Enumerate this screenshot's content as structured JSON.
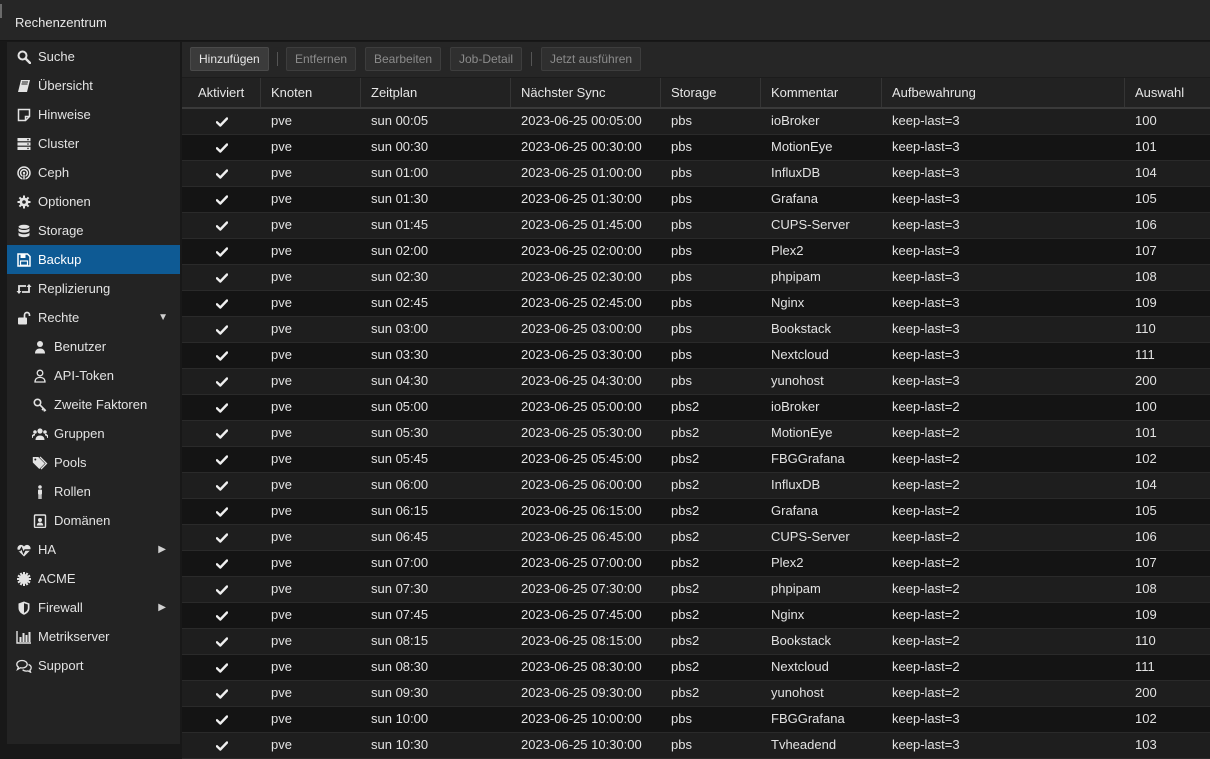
{
  "window": {
    "title": "Rechenzentrum"
  },
  "sidebar": {
    "items": [
      {
        "label": "Suche",
        "icon": "search-icon"
      },
      {
        "label": "Übersicht",
        "icon": "book-icon"
      },
      {
        "label": "Hinweise",
        "icon": "note-icon"
      },
      {
        "label": "Cluster",
        "icon": "server-icon"
      },
      {
        "label": "Ceph",
        "icon": "ceph-icon"
      },
      {
        "label": "Optionen",
        "icon": "gear-icon"
      },
      {
        "label": "Storage",
        "icon": "database-icon"
      },
      {
        "label": "Backup",
        "icon": "floppy-icon",
        "active": true
      },
      {
        "label": "Replizierung",
        "icon": "retweet-icon"
      },
      {
        "label": "Rechte",
        "icon": "unlock-icon",
        "expanded": true
      },
      {
        "label": "Benutzer",
        "icon": "user-icon",
        "sub": true
      },
      {
        "label": "API-Token",
        "icon": "user-outline-icon",
        "sub": true
      },
      {
        "label": "Zweite Faktoren",
        "icon": "key-icon",
        "sub": true
      },
      {
        "label": "Gruppen",
        "icon": "users-icon",
        "sub": true
      },
      {
        "label": "Pools",
        "icon": "tags-icon",
        "sub": true
      },
      {
        "label": "Rollen",
        "icon": "male-icon",
        "sub": true
      },
      {
        "label": "Domänen",
        "icon": "id-card-icon",
        "sub": true
      },
      {
        "label": "HA",
        "icon": "heartbeat-icon",
        "collapsed": true
      },
      {
        "label": "ACME",
        "icon": "certificate-icon"
      },
      {
        "label": "Firewall",
        "icon": "shield-icon",
        "collapsed": true
      },
      {
        "label": "Metrikserver",
        "icon": "bar-chart-icon"
      },
      {
        "label": "Support",
        "icon": "comments-icon"
      }
    ]
  },
  "toolbar": {
    "add": "Hinzufügen",
    "remove": "Entfernen",
    "edit": "Bearbeiten",
    "job_detail": "Job-Detail",
    "run_now": "Jetzt ausführen"
  },
  "table": {
    "columns": [
      "Aktiviert",
      "Knoten",
      "Zeitplan",
      "Nächster Sync",
      "Storage",
      "Kommentar",
      "Aufbewahrung",
      "Auswahl"
    ],
    "rows": [
      {
        "node": "pve",
        "schedule": "sun 00:05",
        "next": "2023-06-25 00:05:00",
        "storage": "pbs",
        "comment": "ioBroker",
        "retention": "keep-last=3",
        "selection": "100"
      },
      {
        "node": "pve",
        "schedule": "sun 00:30",
        "next": "2023-06-25 00:30:00",
        "storage": "pbs",
        "comment": "MotionEye",
        "retention": "keep-last=3",
        "selection": "101"
      },
      {
        "node": "pve",
        "schedule": "sun 01:00",
        "next": "2023-06-25 01:00:00",
        "storage": "pbs",
        "comment": "InfluxDB",
        "retention": "keep-last=3",
        "selection": "104"
      },
      {
        "node": "pve",
        "schedule": "sun 01:30",
        "next": "2023-06-25 01:30:00",
        "storage": "pbs",
        "comment": "Grafana",
        "retention": "keep-last=3",
        "selection": "105"
      },
      {
        "node": "pve",
        "schedule": "sun 01:45",
        "next": "2023-06-25 01:45:00",
        "storage": "pbs",
        "comment": "CUPS-Server",
        "retention": "keep-last=3",
        "selection": "106"
      },
      {
        "node": "pve",
        "schedule": "sun 02:00",
        "next": "2023-06-25 02:00:00",
        "storage": "pbs",
        "comment": "Plex2",
        "retention": "keep-last=3",
        "selection": "107"
      },
      {
        "node": "pve",
        "schedule": "sun 02:30",
        "next": "2023-06-25 02:30:00",
        "storage": "pbs",
        "comment": "phpipam",
        "retention": "keep-last=3",
        "selection": "108"
      },
      {
        "node": "pve",
        "schedule": "sun 02:45",
        "next": "2023-06-25 02:45:00",
        "storage": "pbs",
        "comment": "Nginx",
        "retention": "keep-last=3",
        "selection": "109"
      },
      {
        "node": "pve",
        "schedule": "sun 03:00",
        "next": "2023-06-25 03:00:00",
        "storage": "pbs",
        "comment": "Bookstack",
        "retention": "keep-last=3",
        "selection": "110"
      },
      {
        "node": "pve",
        "schedule": "sun 03:30",
        "next": "2023-06-25 03:30:00",
        "storage": "pbs",
        "comment": "Nextcloud",
        "retention": "keep-last=3",
        "selection": "111"
      },
      {
        "node": "pve",
        "schedule": "sun 04:30",
        "next": "2023-06-25 04:30:00",
        "storage": "pbs",
        "comment": "yunohost",
        "retention": "keep-last=3",
        "selection": "200"
      },
      {
        "node": "pve",
        "schedule": "sun 05:00",
        "next": "2023-06-25 05:00:00",
        "storage": "pbs2",
        "comment": "ioBroker",
        "retention": "keep-last=2",
        "selection": "100"
      },
      {
        "node": "pve",
        "schedule": "sun 05:30",
        "next": "2023-06-25 05:30:00",
        "storage": "pbs2",
        "comment": "MotionEye",
        "retention": "keep-last=2",
        "selection": "101"
      },
      {
        "node": "pve",
        "schedule": "sun 05:45",
        "next": "2023-06-25 05:45:00",
        "storage": "pbs2",
        "comment": "FBGGrafana",
        "retention": "keep-last=2",
        "selection": "102"
      },
      {
        "node": "pve",
        "schedule": "sun 06:00",
        "next": "2023-06-25 06:00:00",
        "storage": "pbs2",
        "comment": "InfluxDB",
        "retention": "keep-last=2",
        "selection": "104"
      },
      {
        "node": "pve",
        "schedule": "sun 06:15",
        "next": "2023-06-25 06:15:00",
        "storage": "pbs2",
        "comment": "Grafana",
        "retention": "keep-last=2",
        "selection": "105"
      },
      {
        "node": "pve",
        "schedule": "sun 06:45",
        "next": "2023-06-25 06:45:00",
        "storage": "pbs2",
        "comment": "CUPS-Server",
        "retention": "keep-last=2",
        "selection": "106"
      },
      {
        "node": "pve",
        "schedule": "sun 07:00",
        "next": "2023-06-25 07:00:00",
        "storage": "pbs2",
        "comment": "Plex2",
        "retention": "keep-last=2",
        "selection": "107"
      },
      {
        "node": "pve",
        "schedule": "sun 07:30",
        "next": "2023-06-25 07:30:00",
        "storage": "pbs2",
        "comment": "phpipam",
        "retention": "keep-last=2",
        "selection": "108"
      },
      {
        "node": "pve",
        "schedule": "sun 07:45",
        "next": "2023-06-25 07:45:00",
        "storage": "pbs2",
        "comment": "Nginx",
        "retention": "keep-last=2",
        "selection": "109"
      },
      {
        "node": "pve",
        "schedule": "sun 08:15",
        "next": "2023-06-25 08:15:00",
        "storage": "pbs2",
        "comment": "Bookstack",
        "retention": "keep-last=2",
        "selection": "110"
      },
      {
        "node": "pve",
        "schedule": "sun 08:30",
        "next": "2023-06-25 08:30:00",
        "storage": "pbs2",
        "comment": "Nextcloud",
        "retention": "keep-last=2",
        "selection": "111"
      },
      {
        "node": "pve",
        "schedule": "sun 09:30",
        "next": "2023-06-25 09:30:00",
        "storage": "pbs2",
        "comment": "yunohost",
        "retention": "keep-last=2",
        "selection": "200"
      },
      {
        "node": "pve",
        "schedule": "sun 10:00",
        "next": "2023-06-25 10:00:00",
        "storage": "pbs",
        "comment": "FBGGrafana",
        "retention": "keep-last=3",
        "selection": "102"
      },
      {
        "node": "pve",
        "schedule": "sun 10:30",
        "next": "2023-06-25 10:30:00",
        "storage": "pbs",
        "comment": "Tvheadend",
        "retention": "keep-last=3",
        "selection": "103"
      }
    ]
  },
  "colors": {
    "active": "#0e5a94",
    "background": "#181818",
    "panel": "#232323"
  }
}
